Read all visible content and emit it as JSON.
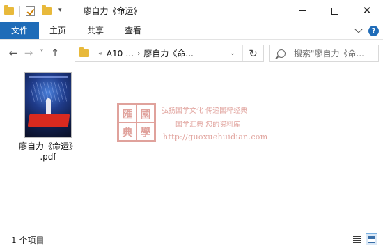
{
  "window": {
    "title": "廖自力《命运》"
  },
  "ribbon": {
    "tabs": [
      "文件",
      "主页",
      "共享",
      "查看"
    ],
    "help_label": "?"
  },
  "nav": {
    "back": "←",
    "forward": "→",
    "recent": "˅",
    "up": "↑"
  },
  "address": {
    "overflow": "«",
    "crumbs": [
      "A10-...",
      "廖自力《命..."
    ],
    "separator": "›",
    "refresh": "↻"
  },
  "search": {
    "placeholder": "搜索\"廖自力《命..."
  },
  "files": [
    {
      "name_line1": "廖自力《命运》",
      "name_line2": ".pdf",
      "icon": "pdf-cover-thumbnail"
    }
  ],
  "watermark": {
    "seal_chars": [
      "匯",
      "國",
      "典",
      "學"
    ],
    "line1": "弘扬国学文化  传递国粹经典",
    "line2": "国学汇典  您的资料库",
    "url": "http://guoxuehuidian.com"
  },
  "status": {
    "item_count": "1 个项目"
  },
  "colors": {
    "accent": "#1f6cb8",
    "folder": "#e8b93b",
    "watermark": "#c8574c"
  }
}
